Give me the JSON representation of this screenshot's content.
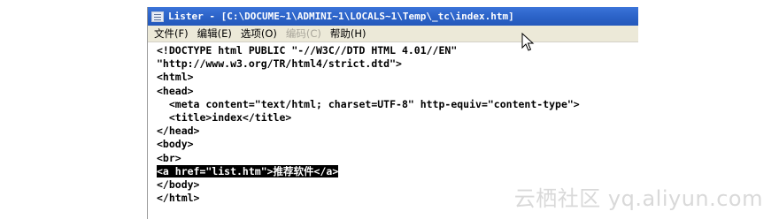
{
  "window": {
    "title": "Lister - [C:\\DOCUME~1\\ADMINI~1\\LOCALS~1\\Temp\\_tc\\index.htm]"
  },
  "menu": {
    "items": [
      {
        "label": "文件(F)",
        "enabled": true
      },
      {
        "label": "编辑(E)",
        "enabled": true
      },
      {
        "label": "选项(O)",
        "enabled": true
      },
      {
        "label": "编码(C)",
        "enabled": false
      },
      {
        "label": "帮助(H)",
        "enabled": true
      }
    ]
  },
  "content": {
    "lines": [
      "<!DOCTYPE html PUBLIC \"-//W3C//DTD HTML 4.01//EN\"",
      "\"http://www.w3.org/TR/html4/strict.dtd\">",
      "<html>",
      "<head>",
      "  <meta content=\"text/html; charset=UTF-8\" http-equiv=\"content-type\">",
      "  <title>index</title>",
      "</head>",
      "<body>",
      "<br>",
      "</body>",
      "</html>"
    ],
    "selected_line": "<a href=\"list.htm\">推荐软件</a>"
  },
  "watermark": {
    "text": "云栖社区 yq.aliyun.com"
  },
  "colors": {
    "titlebar": "#2b62c7",
    "menubar": "#ece9d8",
    "selection_bg": "#000000",
    "selection_fg": "#ffffff"
  }
}
